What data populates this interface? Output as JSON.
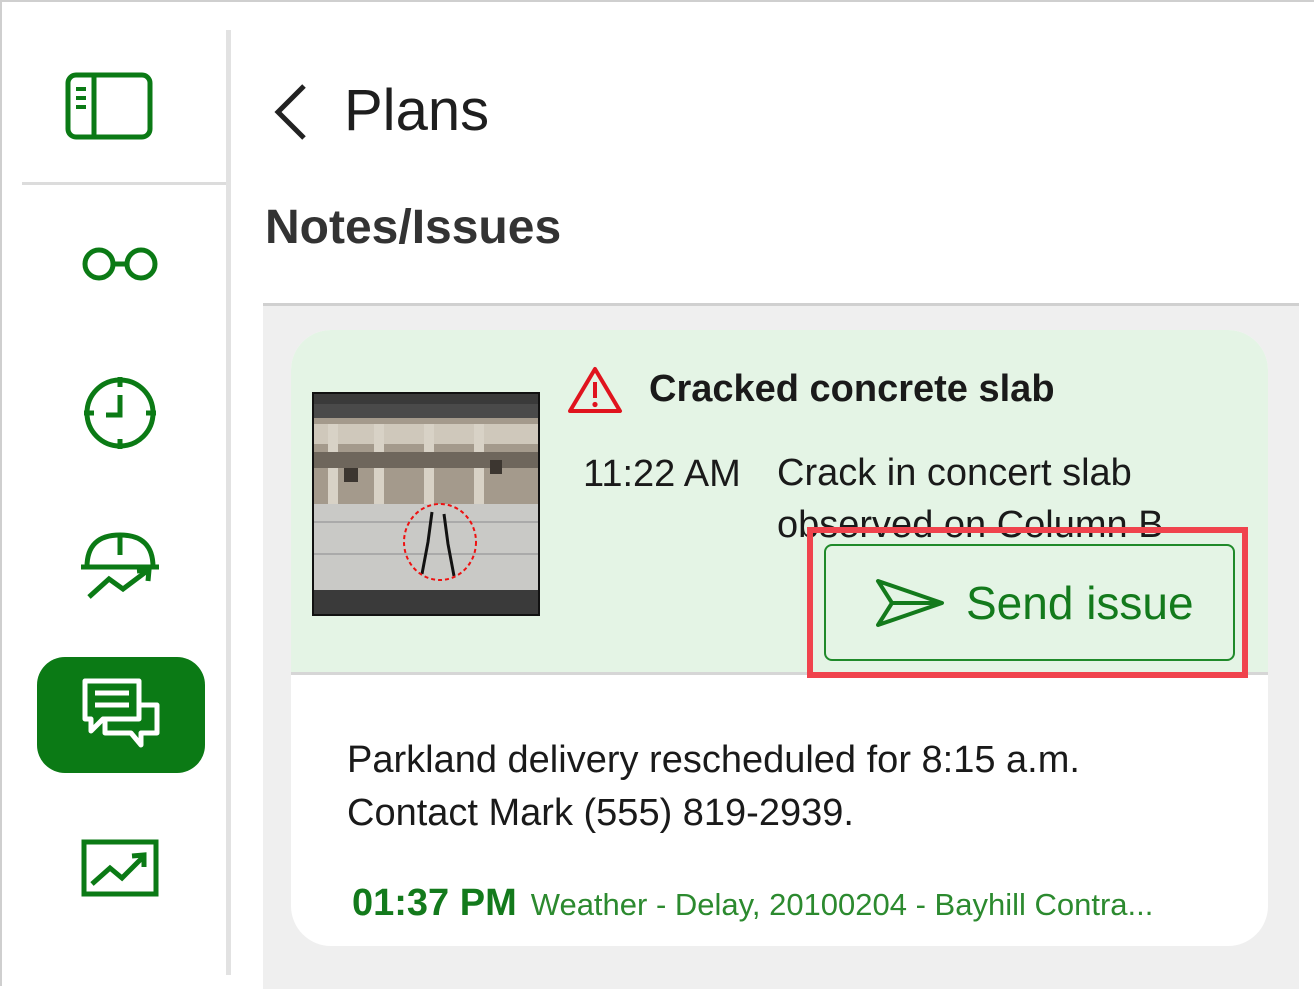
{
  "header": {
    "title": "Plans",
    "section_title": "Notes/Issues"
  },
  "sidebar": {
    "items": [
      {
        "icon": "panel-toggle-icon",
        "active": false
      },
      {
        "icon": "glasses-icon",
        "active": false
      },
      {
        "icon": "clock-icon",
        "active": false
      },
      {
        "icon": "hardhat-trend-icon",
        "active": false
      },
      {
        "icon": "chat-bubbles-icon",
        "active": true
      },
      {
        "icon": "trend-chart-icon",
        "active": false
      }
    ]
  },
  "issue": {
    "title": "Cracked concrete slab",
    "time": "11:22 AM",
    "description": "Crack in concert slab observed on Column B",
    "send_label": "Send issue"
  },
  "note": {
    "text": "Parkland delivery rescheduled for 8:15 a.m. Contact Mark (555) 819-2939.",
    "time": "01:37 PM",
    "subtitle": "Weather  -  Delay, 20100204 - Bayhill Contra..."
  },
  "colors": {
    "accent": "#0b7a15",
    "issue_bg": "#e4f4e5",
    "highlight": "#f0434d",
    "warning": "#e0141e"
  }
}
